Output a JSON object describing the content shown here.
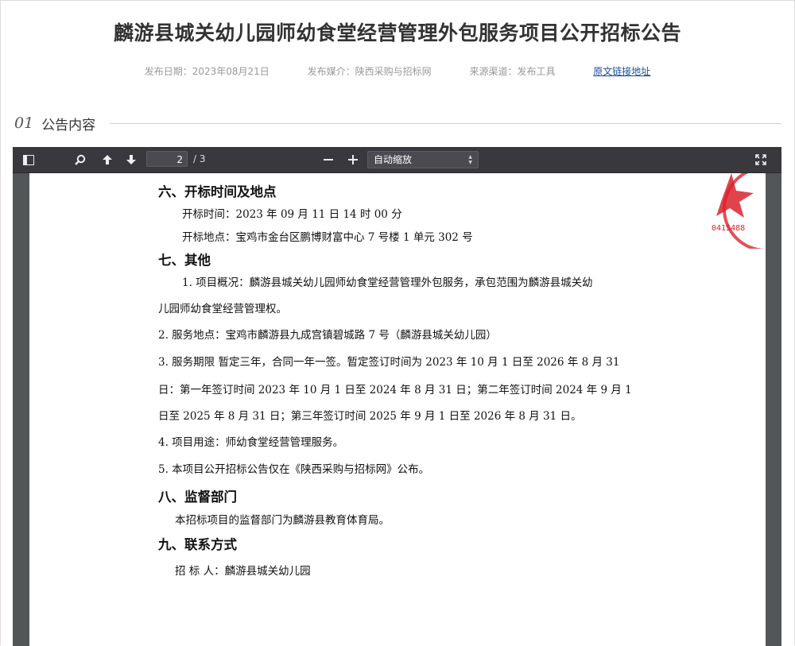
{
  "header": {
    "title": "麟游县城关幼儿园师幼食堂经营管理外包服务项目公开招标公告",
    "publish_date": "发布日期：2023年08月21日",
    "publish_media": "发布媒介：陕西采购与招标网",
    "source": "来源渠道：发布工具",
    "original_link": "原文链接地址"
  },
  "section": {
    "number": "01",
    "title": "公告内容"
  },
  "viewer": {
    "page_current": "2",
    "page_total": "/ 3",
    "zoom_label": "自动缩放",
    "icons": [
      "sidebar-toggle-icon",
      "search-icon",
      "arrow-up-icon",
      "arrow-down-icon",
      "zoom-out-icon",
      "zoom-in-icon",
      "fullscreen-icon",
      "chevron-down-icon"
    ]
  },
  "document": {
    "lines": [
      "六、开标时间及地点",
      "开标时间：2023 年 09 月 11 日  14 时 00 分",
      "开标地点：宝鸡市金台区鹏博财富中心 7 号楼 1 单元 302 号",
      "七、其他",
      "1. 项目概况：麟游县城关幼儿园师幼食堂经营管理外包服务，承包范围为麟游县城关幼",
      "儿园师幼食堂经营管理权。",
      "2. 服务地点：宝鸡市麟游县九成宫镇碧城路 7 号（麟游县城关幼儿园）",
      "3. 服务期限  暂定三年，合同一年一签。暂定签订时间为 2023 年 10 月 1 日至 2026 年 8 月 31",
      "日：第一年签订时间 2023 年 10 月 1 日至 2024 年 8 月 31 日；第二年签订时间 2024 年 9 月 1",
      "日至 2025 年 8 月 31 日；第三年签订时间 2025 年 9 月 1 日至 2026 年 8 月 31 日。",
      "4. 项目用途：师幼食堂经营管理服务。",
      "5. 本项目公开招标公告仅在《陕西采购与招标网》公布。",
      "八、监督部门",
      "本招标项目的监督部门为麟游县教育体育局。",
      "九、联系方式",
      "招  标  人：麟游县城关幼儿园"
    ],
    "seal_text": "0415488"
  },
  "colors": {
    "accent_link": "#1a4f9c",
    "toolbar": "#38383d",
    "viewer_bg": "#525659",
    "seal": "#d9232e"
  }
}
